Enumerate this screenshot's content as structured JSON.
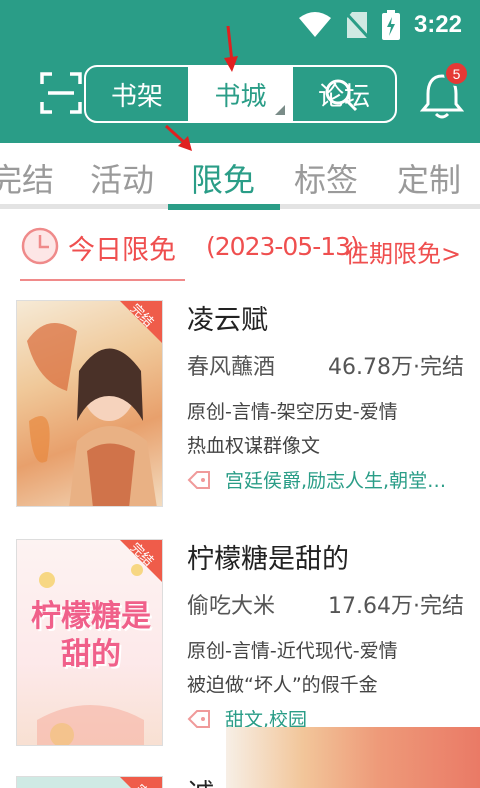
{
  "status_bar": {
    "time": "3:22"
  },
  "header": {
    "segments": [
      {
        "label": "书架",
        "active": false
      },
      {
        "label": "书城",
        "active": true
      },
      {
        "label": "论坛",
        "active": false
      }
    ],
    "notification_count": "5"
  },
  "tabs": [
    {
      "label": "完结",
      "active": false
    },
    {
      "label": "活动",
      "active": false
    },
    {
      "label": "限免",
      "active": true
    },
    {
      "label": "标签",
      "active": false
    },
    {
      "label": "定制",
      "active": false
    }
  ],
  "free_section": {
    "title": "今日限免",
    "date": "(2023-05-13)",
    "past_link": "往期限免>"
  },
  "books": [
    {
      "title": "凌云赋",
      "author": "春风蘸酒",
      "stats": "46.78万·完结",
      "category": "原创-言情-架空历史-爱情",
      "desc": "热血权谋群像文",
      "tags": "宫廷侯爵,励志人生,朝堂…",
      "corner_label": "完结"
    },
    {
      "title": "柠檬糖是甜的",
      "author": "偷吃大米",
      "stats": "17.64万·完结",
      "category": "原创-言情-近代现代-爱情",
      "desc": "被迫做“坏人”的假千金",
      "tags": "甜文,校园",
      "corner_label": "完结",
      "cover_text": "柠檬糖是甜的"
    },
    {
      "title": "诚",
      "corner_label": "完"
    }
  ],
  "colors": {
    "primary": "#2a9d87",
    "accent_red": "#ef4f4f",
    "muted": "#9a9a9a"
  }
}
